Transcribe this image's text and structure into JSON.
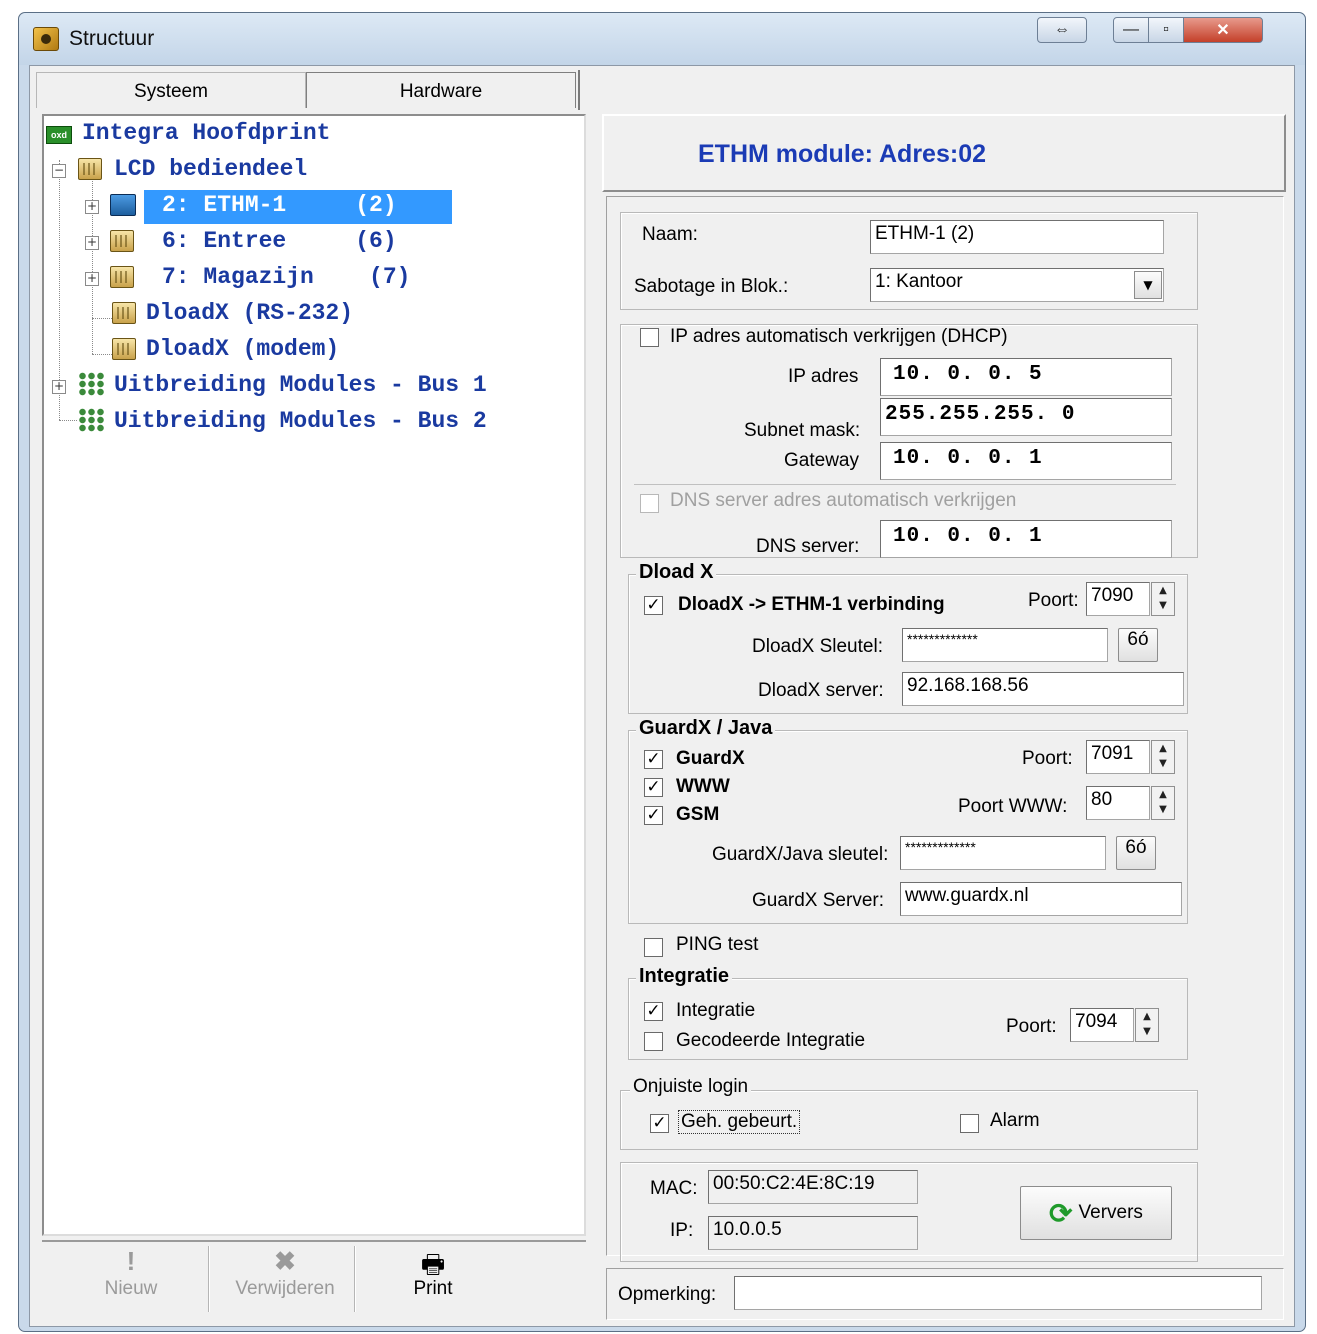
{
  "window": {
    "title": "Structuur",
    "swap_symbol": "⇔",
    "min_symbol": "—",
    "max_symbol": "▫",
    "close_symbol": "✕"
  },
  "tabs": [
    {
      "label": "Systeem"
    },
    {
      "label": "Hardware"
    }
  ],
  "tree": {
    "root": {
      "label": "Integra Hoofdprint",
      "icon": "circuit-board-icon"
    },
    "lcd": {
      "label": "LCD bediendeel",
      "icon": "keypad-icon"
    },
    "items": [
      {
        "label": "2: ETHM-1     (2)",
        "icon": "network-module-icon",
        "selected": true
      },
      {
        "label": "6: Entree     (6)",
        "icon": "keypad-icon"
      },
      {
        "label": "7: Magazijn    (7)",
        "icon": "keypad-icon"
      },
      {
        "label": "DloadX (RS-232)",
        "icon": "keypad-icon"
      },
      {
        "label": "DloadX (modem)",
        "icon": "keypad-icon"
      }
    ],
    "bus1": {
      "label": "Uitbreiding Modules - Bus 1",
      "icon": "bus-modules-icon"
    },
    "bus2": {
      "label": "Uitbreiding Modules - Bus 2",
      "icon": "bus-modules-icon"
    },
    "expander_plus": "+",
    "expander_minus": "−"
  },
  "toolbar": {
    "new_label": "Nieuw",
    "delete_label": "Verwijderen",
    "print_label": "Print"
  },
  "panel": {
    "title": "ETHM module: Adres:02",
    "naam_label": "Naam:",
    "naam_value": "ETHM-1     (2)",
    "sabotage_label": "Sabotage in Blok.:",
    "sabotage_value": "1: Kantoor",
    "dhcp_label": "IP adres automatisch verkrijgen (DHCP)",
    "ip_label": "IP adres",
    "ip_value": "10.  0.  0.  5",
    "subnet_label": "Subnet mask:",
    "subnet_value": "255.255.255.  0",
    "gateway_label": "Gateway",
    "gateway_value": "10.  0.  0.  1",
    "dns_auto_label": "DNS server adres automatisch verkrijgen",
    "dns_label": "DNS server:",
    "dns_value": "10.  0.  0.  1",
    "dloadx": {
      "group_title": "Dload X",
      "connection_label": "DloadX -> ETHM-1 verbinding",
      "port_label": "Poort:",
      "port_value": "7090",
      "key_label": "DloadX Sleutel:",
      "key_value": "*************",
      "key_button": "6ó",
      "server_label": "DloadX server:",
      "server_value": "92.168.168.56"
    },
    "guardx": {
      "group_title": "GuardX / Java",
      "guardx_label": "GuardX",
      "www_label": "WWW",
      "gsm_label": "GSM",
      "port_label": "Poort:",
      "port_value": "7091",
      "port_www_label": "Poort WWW:",
      "port_www_value": "80",
      "key_label": "GuardX/Java sleutel:",
      "key_value": "*************",
      "key_button": "6ó",
      "server_label": "GuardX Server:",
      "server_value": "www.guardx.nl"
    },
    "ping_label": "PING test",
    "integratie": {
      "group_title": "Integratie",
      "integratie_label": "Integratie",
      "encoded_label": "Gecodeerde Integratie",
      "port_label": "Poort:",
      "port_value": "7094"
    },
    "login": {
      "group_title": "Onjuiste login",
      "event_label": "Geh. gebeurt.",
      "alarm_label": "Alarm"
    },
    "mac_label": "MAC:",
    "mac_value": "00:50:C2:4E:8C:19",
    "ip_status_label": "IP:",
    "ip_status_value": "10.0.0.5",
    "refresh_label": "Ververs",
    "remark_label": "Opmerking:",
    "remark_value": "",
    "check_mark": "✓",
    "spin_up": "▲",
    "spin_down": "▼",
    "dropdown_arrow": "▼"
  }
}
